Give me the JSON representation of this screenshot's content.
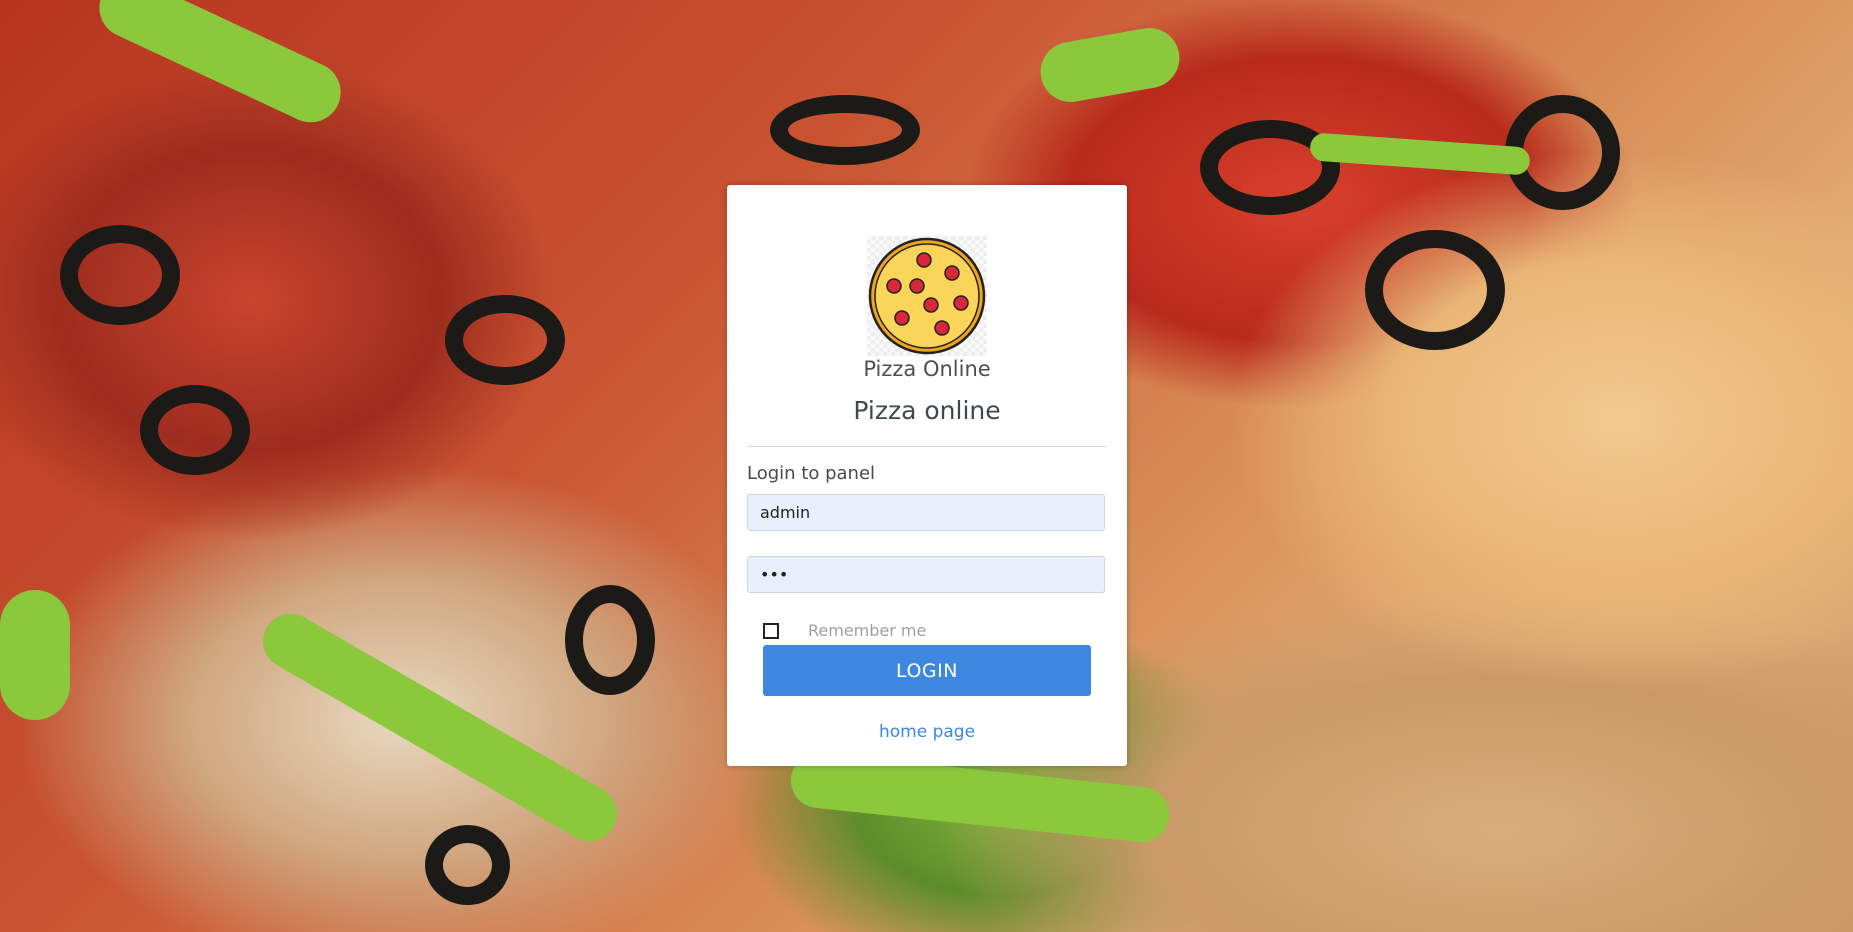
{
  "brand": {
    "name": "Pizza Online",
    "logo_icon": "pizza-icon"
  },
  "page": {
    "title": "Pizza online"
  },
  "form": {
    "heading": "Login to panel",
    "username_value": "admin",
    "password_value": "•••",
    "remember_label": "Remember me",
    "remember_checked": false,
    "login_label": "LOGIN"
  },
  "links": {
    "home_label": "home page"
  },
  "colors": {
    "accent": "#3d87e0",
    "input_bg": "#e8f0fe",
    "card_bg": "#ffffff"
  },
  "background": {
    "description_icon": "pizza-photo-background"
  }
}
